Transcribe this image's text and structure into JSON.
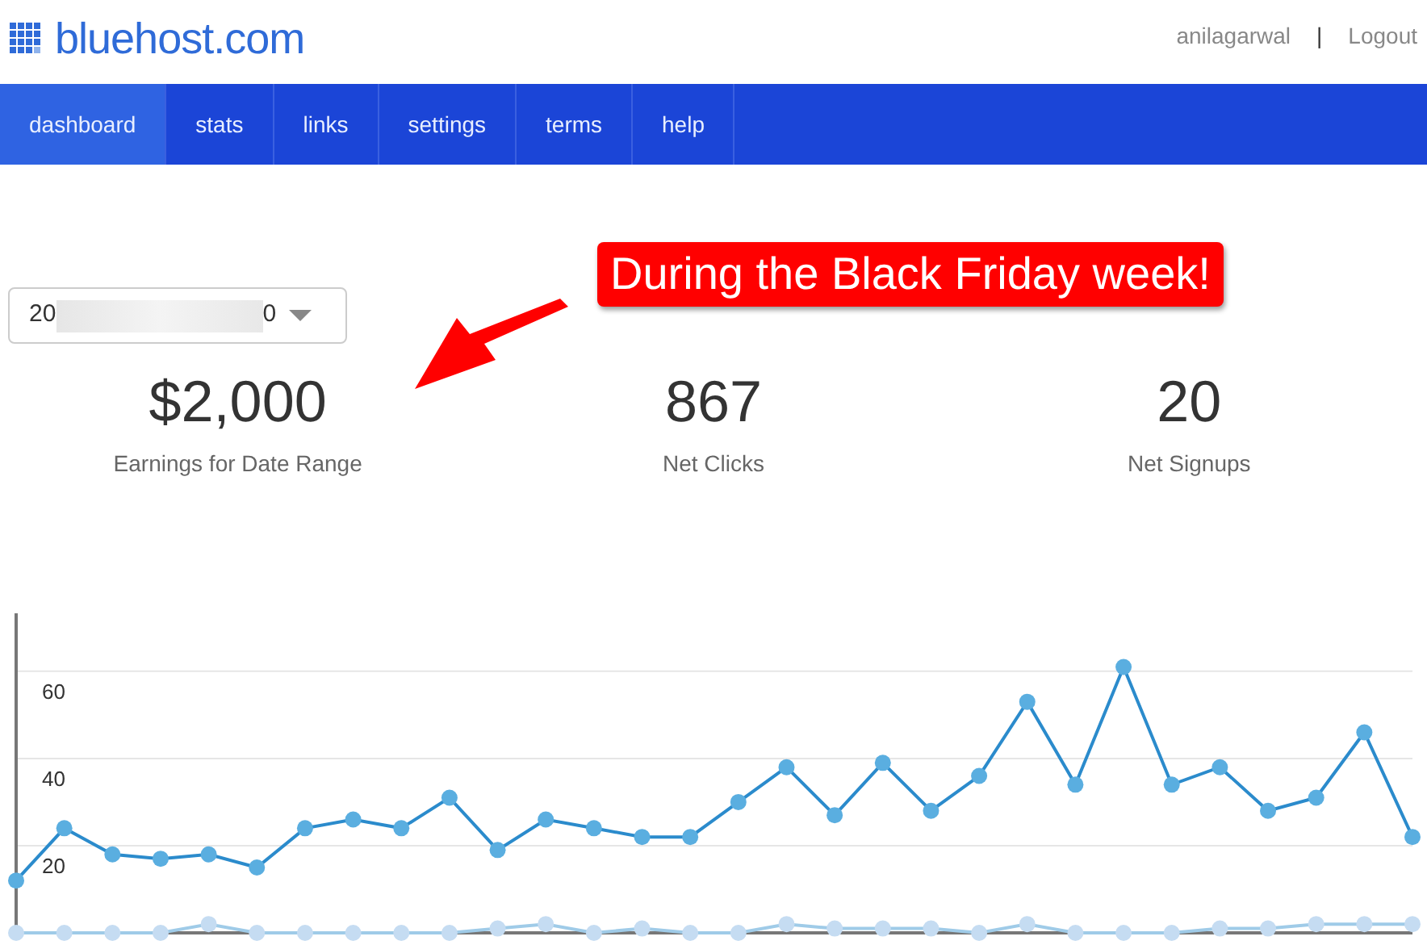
{
  "header": {
    "logo": "bluehost.com",
    "username": "anilagarwal",
    "separator": "|",
    "logout": "Logout"
  },
  "tabs": [
    {
      "label": "dashboard",
      "selected": true
    },
    {
      "label": "stats",
      "selected": false
    },
    {
      "label": "links",
      "selected": false
    },
    {
      "label": "settings",
      "selected": false
    },
    {
      "label": "terms",
      "selected": false
    },
    {
      "label": "help",
      "selected": false
    }
  ],
  "date_range": {
    "visible_start": "20",
    "visible_end": "0",
    "redacted": true
  },
  "callout": {
    "text": "During the Black Friday week!"
  },
  "stats": [
    {
      "value": "$2,000",
      "label": "Earnings for Date Range"
    },
    {
      "value": "867",
      "label": "Net Clicks"
    },
    {
      "value": "20",
      "label": "Net Signups"
    }
  ],
  "chart_data": {
    "type": "line",
    "ylim": [
      0,
      73.3
    ],
    "yticks": [
      20,
      40,
      60
    ],
    "grid": true,
    "series": [
      {
        "color": "#2b8bcc",
        "marker": true,
        "values": [
          12,
          24,
          18,
          17,
          18,
          15,
          24,
          26,
          24,
          31,
          19,
          26,
          24,
          22,
          22,
          30,
          38,
          27,
          39,
          28,
          36,
          53,
          34,
          61,
          34,
          38,
          28,
          31,
          46,
          22
        ]
      },
      {
        "color": "#9fcbe8",
        "marker": true,
        "values": [
          0,
          0,
          0,
          0,
          2,
          0,
          0,
          0,
          0,
          0,
          1,
          2,
          0,
          1,
          0,
          0,
          2,
          1,
          1,
          1,
          0,
          2,
          0,
          0,
          0,
          1,
          1,
          2,
          2,
          2
        ]
      }
    ]
  }
}
